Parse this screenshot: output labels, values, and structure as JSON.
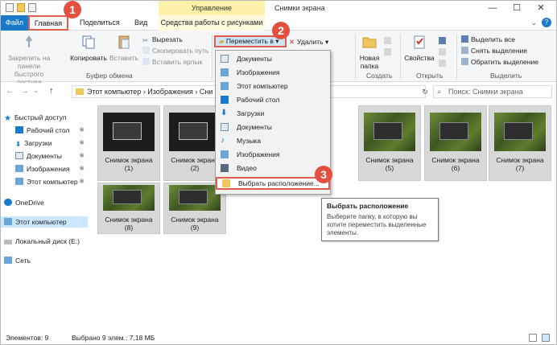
{
  "titlebar": {
    "context_label": "Управление",
    "title": "Снимки экрана",
    "minimize": "—",
    "maximize": "☐",
    "close": "✕"
  },
  "tabs": {
    "file": "Файл",
    "home": "Главная",
    "share": "Поделиться",
    "view": "Вид",
    "tools": "Средства работы с рисунками",
    "help": "?"
  },
  "ribbon": {
    "pin_label": "Закрепить на панели быстрого доступа",
    "copy_label": "Копировать",
    "paste_label": "Вставить",
    "cut_label": "Вырезать",
    "copy_path_label": "Скопировать путь",
    "paste_shortcut_label": "Вставить ярлык",
    "clipboard_group": "Буфер обмена",
    "move_label": "Переместить в",
    "delete_label": "Удалить",
    "new_folder_label": "Новая папка",
    "create_group": "Создать",
    "properties_label": "Свойства",
    "open_group": "Открыть",
    "select_all": "Выделить все",
    "select_none": "Снять выделение",
    "invert_selection": "Обратить выделение",
    "select_group": "Выделить"
  },
  "address": {
    "path": "Этот компьютер  ›  Изображения  ›  Сни",
    "search_placeholder": "Поиск: Снимки экрана",
    "back": "←",
    "forward": "→",
    "recent": "⌄",
    "up": "↑",
    "refresh": "↻",
    "search_icon": "⌕"
  },
  "sidebar": {
    "items": [
      {
        "label": "Быстрый доступ",
        "pinned": ""
      },
      {
        "label": "Рабочий стол",
        "pinned": "✱"
      },
      {
        "label": "Загрузки",
        "pinned": "✱"
      },
      {
        "label": "Документы",
        "pinned": "✱"
      },
      {
        "label": "Изображения",
        "pinned": "✱"
      },
      {
        "label": "Этот компьютер",
        "pinned": "✱"
      },
      {
        "label": "OneDrive",
        "pinned": ""
      },
      {
        "label": "Этот компьютер",
        "pinned": ""
      },
      {
        "label": "Локальный диск (E:)",
        "pinned": ""
      },
      {
        "label": "Сеть",
        "pinned": ""
      }
    ]
  },
  "files": [
    {
      "name": "Снимок экрана",
      "num": "(1)"
    },
    {
      "name": "Снимок экрана",
      "num": "(2)"
    },
    {
      "name": "Снимок экрана",
      "num": "(5)"
    },
    {
      "name": "Снимок экрана",
      "num": "(6)"
    },
    {
      "name": "Снимок экрана",
      "num": "(7)"
    },
    {
      "name": "Снимок экрана",
      "num": "(8)"
    },
    {
      "name": "Снимок экрана",
      "num": "(9)"
    }
  ],
  "menu": {
    "items": [
      "Документы",
      "Изображения",
      "Этот компьютер",
      "Рабочий стол",
      "Загрузки",
      "Документы",
      "Музыка",
      "Изображения",
      "Видео",
      "Выбрать расположение..."
    ]
  },
  "tooltip": {
    "title": "Выбрать расположение",
    "body": "Выберите папку, в которую вы хотите переместить выделенные элементы."
  },
  "badges": [
    "1",
    "2",
    "3"
  ],
  "status": {
    "count": "Элементов: 9",
    "selected": "Выбрано 9 элем.: 7,18 МБ"
  },
  "colors": {
    "accent": "#1979ca",
    "highlight_red": "#e25b4e",
    "context_yellow": "#fdf1a9",
    "selection_blue": "#cce8ff"
  }
}
